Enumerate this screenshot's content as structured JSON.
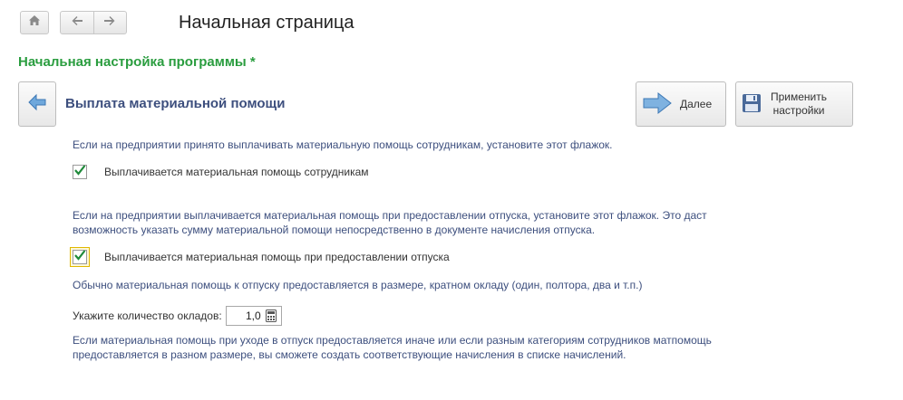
{
  "header": {
    "title": "Начальная страница"
  },
  "section": {
    "title": "Начальная настройка программы *"
  },
  "step": {
    "title": "Выплата материальной помощи"
  },
  "toolbar": {
    "next_label": "Далее",
    "apply_label": "Применить\nнастройки"
  },
  "content": {
    "hint1": "Если на предприятии принято выплачивать материальную помощь сотрудникам, установите этот флажок.",
    "checkbox1": {
      "label": "Выплачивается материальная помощь сотрудникам",
      "checked": true
    },
    "hint2": "Если на предприятии выплачивается материальная помощь при предоставлении отпуска, установите этот флажок. Это даст возможность указать сумму материальной помощи непосредственно в документе начисления отпуска.",
    "checkbox2": {
      "label": "Выплачивается материальная помощь при предоставлении отпуска",
      "checked": true
    },
    "hint3": "Обычно материальная помощь к отпуску предоставляется в размере, кратном окладу (один, полтора, два и т.п.)",
    "quantity": {
      "label": "Укажите количество окладов:",
      "value": "1,0"
    },
    "hint4": "Если материальная помощь при уходе в отпуск предоставляется иначе или если разным категориям сотрудников матпомощь предоставляется в разном размере, вы сможете создать соответствующие начисления в списке начислений."
  },
  "colors": {
    "accent_green": "#2a9d3f",
    "text_blue": "#3d4f7e",
    "check_green": "#1f8a3a"
  }
}
